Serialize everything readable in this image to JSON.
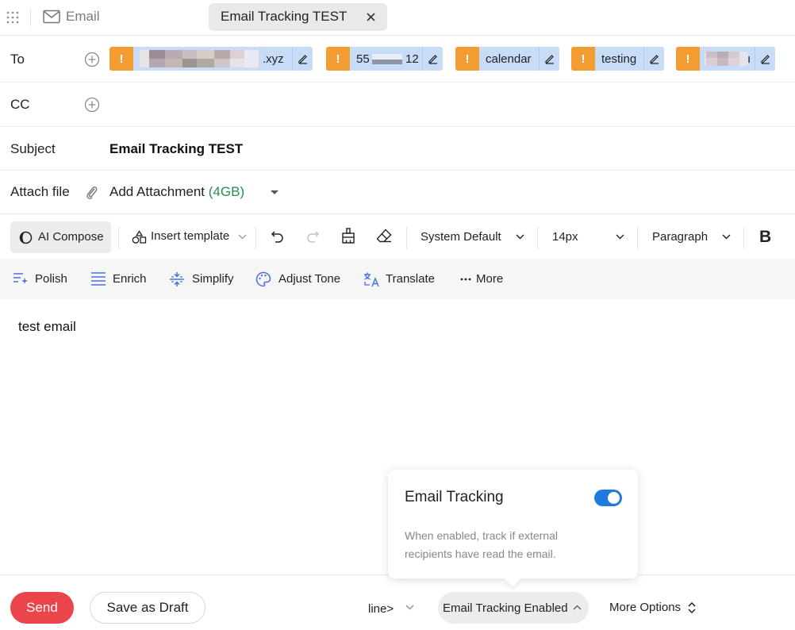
{
  "app": {
    "name": "Email"
  },
  "tab": {
    "title": "Email Tracking TEST"
  },
  "to": {
    "label": "To",
    "recipients": [
      {
        "text": "s……….xyz",
        "suffix": ".xyz",
        "prefix": "s",
        "warning": "!",
        "redacted": true
      },
      {
        "text": "55……12",
        "prefix": "55",
        "suffix": "12",
        "warning": "!",
        "redacted": true
      },
      {
        "text": "calendar",
        "warning": "!",
        "redacted": false
      },
      {
        "text": "testing",
        "warning": "!",
        "redacted": false
      },
      {
        "text": "",
        "suffix": "ı",
        "warning": "!",
        "redacted": true
      }
    ]
  },
  "cc": {
    "label": "CC"
  },
  "subject": {
    "label": "Subject",
    "value": "Email Tracking TEST"
  },
  "attach": {
    "label": "Attach file",
    "text": "Add Attachment",
    "size": "(4GB)"
  },
  "toolbar": {
    "ai_compose": "AI Compose",
    "insert_template": "Insert template",
    "font_family": "System Default",
    "font_size": "14px",
    "block_format": "Paragraph",
    "bold": "B"
  },
  "ai_actions": {
    "polish": "Polish",
    "enrich": "Enrich",
    "simplify": "Simplify",
    "adjust_tone": "Adjust Tone",
    "translate": "Translate",
    "more": "More"
  },
  "editor": {
    "body": "test email"
  },
  "popover": {
    "title": "Email Tracking",
    "enabled": true,
    "description": "When enabled, track if external recipients have read the email."
  },
  "footer": {
    "send": "Send",
    "save_draft": "Save as Draft",
    "line_select": "line>",
    "tracking": "Email Tracking Enabled",
    "more_options": "More Options"
  },
  "colors": {
    "send": "#e9454a",
    "warning": "#f39c32",
    "chip": "#c8dcf7",
    "toggle": "#1f7ae0",
    "attach_size": "#2e8b57"
  }
}
